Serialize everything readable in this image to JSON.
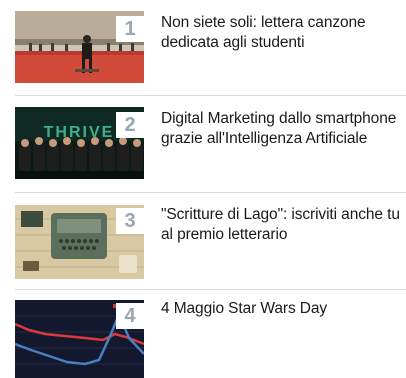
{
  "articles": [
    {
      "rank": "1",
      "title": "Non siete soli: lettera canzone dedicata agli studenti",
      "thumbnail_icon": "gym-photo"
    },
    {
      "rank": "2",
      "title": "Digital Marketing dallo smartphone grazie all'Intelligenza Artificiale",
      "thumbnail_icon": "team-photo",
      "thumbnail_text": "THRIVE"
    },
    {
      "rank": "3",
      "title": "\"Scritture di Lago\": iscriviti anche tu al premio letterario",
      "thumbnail_icon": "typewriter-photo"
    },
    {
      "rank": "4",
      "title": "4 Maggio Star Wars Day",
      "thumbnail_icon": "chart-photo"
    }
  ],
  "colors": {
    "rank_text": "#9aa6b2",
    "title_text": "#1a1a1a",
    "divider": "#dadada"
  }
}
